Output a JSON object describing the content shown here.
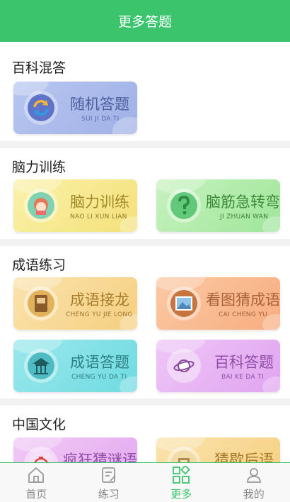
{
  "header": {
    "title": "更多答题"
  },
  "sections": [
    {
      "title": "百科混答",
      "cards": [
        {
          "title": "随机答题",
          "sub": "SUI JI DA TI",
          "icon": "refresh-icon"
        }
      ]
    },
    {
      "title": "脑力训练",
      "cards": [
        {
          "title": "脑力训练",
          "sub": "NAO LI XUN LIAN",
          "icon": "cartoon-girl-icon"
        },
        {
          "title": "脑筋急转弯",
          "sub": "JI ZHUAN WAN",
          "icon": "question-mark-icon"
        }
      ]
    },
    {
      "title": "成语练习",
      "cards": [
        {
          "title": "成语接龙",
          "sub": "CHENG YU JIE LONG",
          "icon": "book-icon"
        },
        {
          "title": "看图猜成语",
          "sub": "CAI CHENG YU",
          "icon": "picture-icon"
        },
        {
          "title": "成语答题",
          "sub": "CHENG YU DA TI",
          "icon": "pavilion-icon"
        },
        {
          "title": "百科答题",
          "sub": "BAI KE DA TI",
          "icon": "planet-icon"
        }
      ]
    },
    {
      "title": "中国文化",
      "cards": [
        {
          "title": "疯狂猜谜语",
          "sub": "",
          "icon": "lantern-icon"
        },
        {
          "title": "猜歇后语",
          "sub": "",
          "icon": "scroll-icon"
        }
      ]
    }
  ],
  "tabbar": [
    {
      "label": "首页",
      "icon": "home-icon",
      "active": false
    },
    {
      "label": "练习",
      "icon": "practice-icon",
      "active": false
    },
    {
      "label": "更多",
      "icon": "grid-icon",
      "active": true
    },
    {
      "label": "我的",
      "icon": "user-icon",
      "active": false
    }
  ],
  "colors": {
    "accent": "#3cc46d"
  }
}
